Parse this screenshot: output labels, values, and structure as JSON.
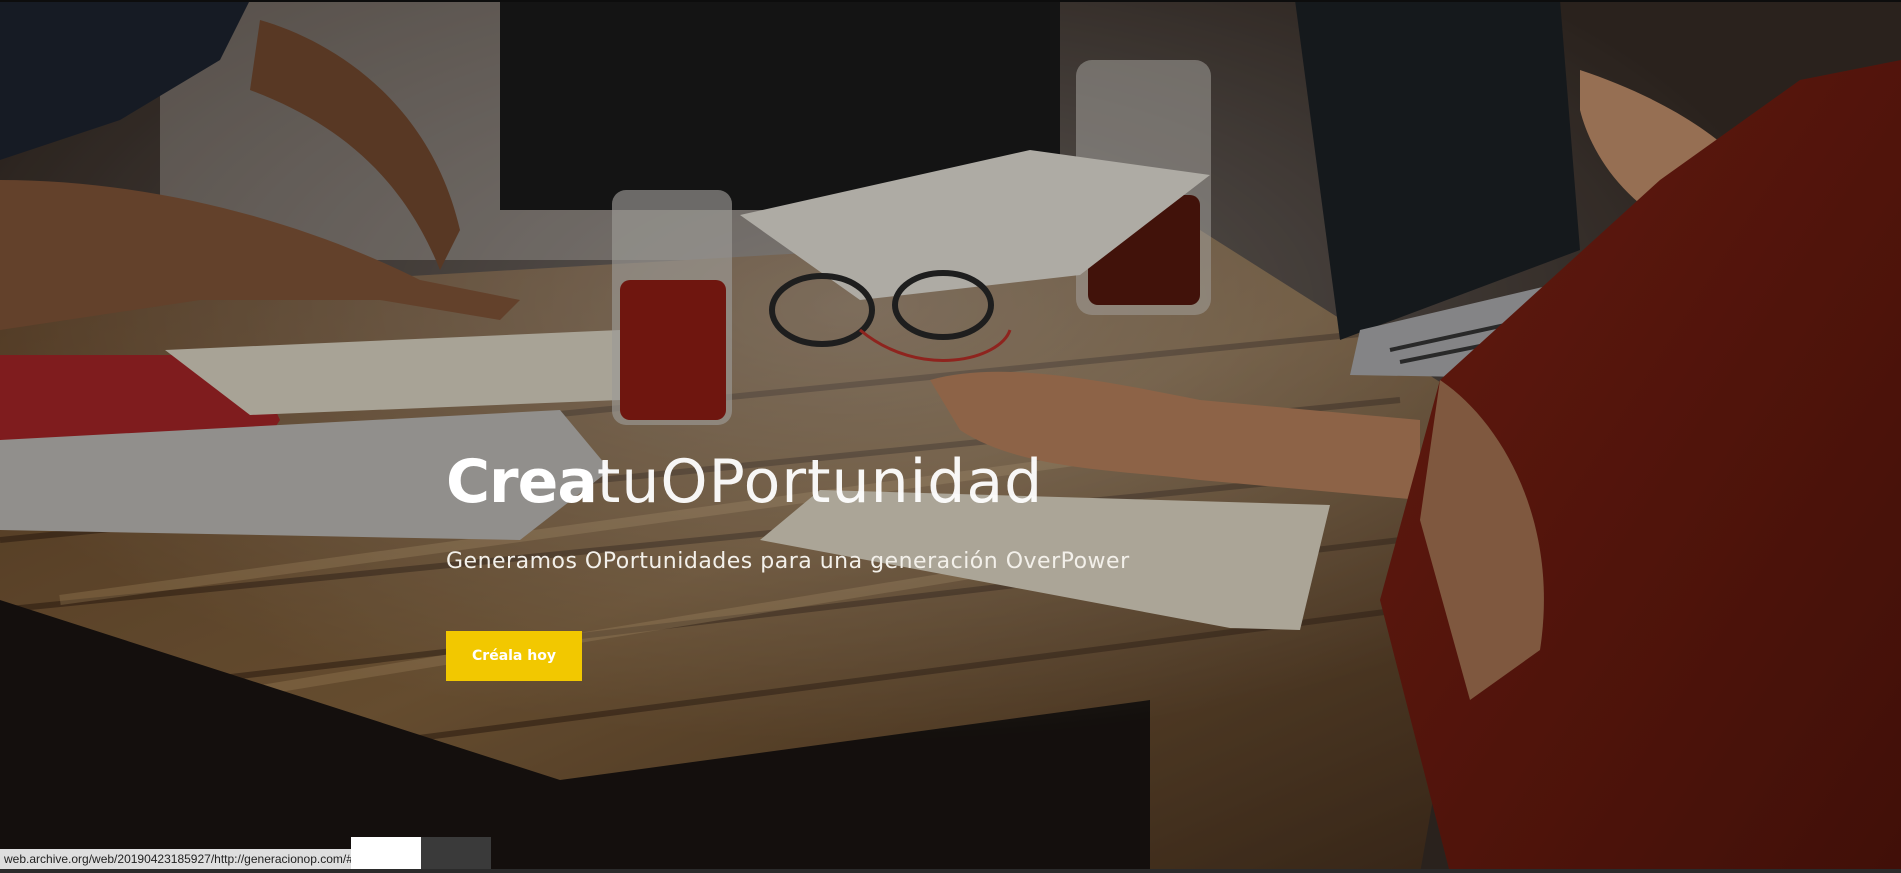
{
  "hero": {
    "headline_bold": "Crea",
    "headline_thin": "tuOPortunidad",
    "subtitle": "Generamos OPortunidades para una generación OverPower",
    "cta_label": "Créala hoy"
  },
  "status_bar": {
    "url": "web.archive.org/web/20190423185927/http://generacionop.com/#"
  },
  "colors": {
    "accent": "#f2c800",
    "hero_text": "#ffffff"
  }
}
